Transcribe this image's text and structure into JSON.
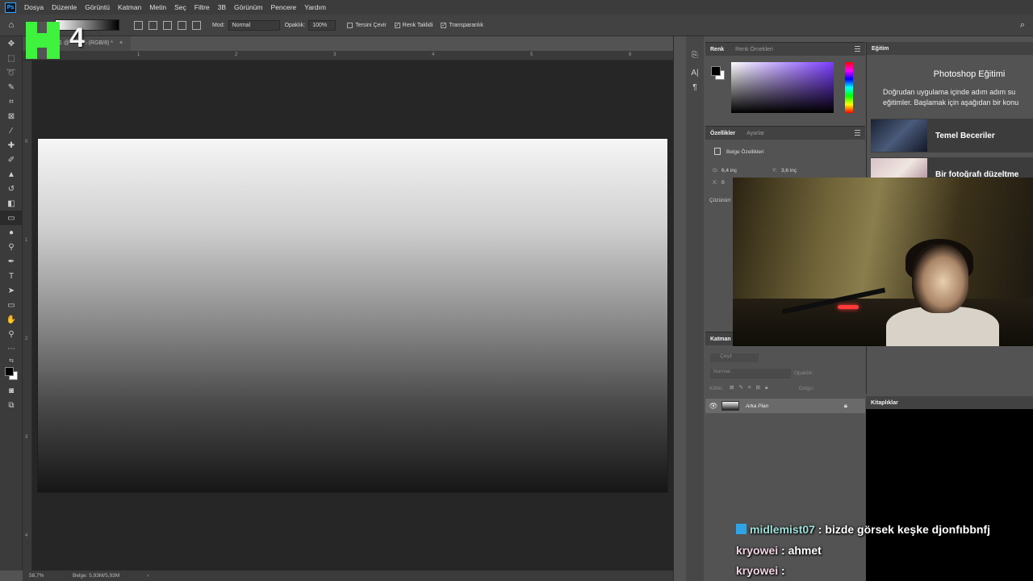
{
  "menubar": {
    "logo": "Ps",
    "items": [
      "Dosya",
      "Düzenle",
      "Görüntü",
      "Katman",
      "Metin",
      "Seç",
      "Filtre",
      "3B",
      "Görünüm",
      "Pencere",
      "Yardım"
    ]
  },
  "options": {
    "mode_label": "Mod:",
    "mode_value": "Normal",
    "opacity_label": "Opaklık:",
    "opacity_value": "100%",
    "reverse_label": "Tersini Çevir",
    "dither_label": "Renk Taklidi",
    "transparency_label": "Transparanlık"
  },
  "document_tab": {
    "title": "1 @ 58,7% (RGB/8) *",
    "close": "×"
  },
  "ruler": {
    "top_ticks": [
      "1",
      "2",
      "3",
      "4",
      "5",
      "6"
    ],
    "left_ticks": [
      "0",
      "1",
      "2",
      "3",
      "4"
    ]
  },
  "status": {
    "zoom": "58,7%",
    "doc_size": "Belge: 5,93M/5,93M",
    "arrow": "›"
  },
  "color_panel": {
    "tabs": [
      "Renk",
      "Renk Örnekleri"
    ]
  },
  "properties_panel": {
    "tabs": [
      "Özellikler",
      "Ayarlar"
    ],
    "section": "Belge Özellikleri",
    "width_label": "G:",
    "width_value": "6,4 inç",
    "height_label": "Y:",
    "height_value": "3,6 inç",
    "x_label": "X:",
    "x_value": "0",
    "resolution_label": "Çözünürl"
  },
  "layers_panel": {
    "title": "Katman",
    "filter_placeholder": "Çeşit",
    "blend": "Normal",
    "opacity_label": "Opaklık:",
    "lock_label": "Kilitle:",
    "fill_label": "Dolgu:",
    "layer_name": "Arka Plan"
  },
  "learn_panel": {
    "tab": "Eğitim",
    "title": "Photoshop Eğitimi",
    "desc_line1": "Doğrudan uygulama içinde adım adım su",
    "desc_line2": "eğitimler. Başlamak için aşağıdan bir konu",
    "cards": [
      "Temel Beceriler",
      "Bir fotoğrafı düzeltme"
    ]
  },
  "libraries_panel": {
    "tab": "Kitaplıklar"
  },
  "overlay": {
    "number": "4"
  },
  "chat": [
    {
      "user": "midlemist07",
      "sep": " : ",
      "message": "bizde görsek keşke djonfıbbnfj"
    },
    {
      "user": "kryowei",
      "sep": " : ",
      "message": "ahmet"
    },
    {
      "user": "kryowei",
      "sep": " : ",
      "message": ""
    }
  ]
}
